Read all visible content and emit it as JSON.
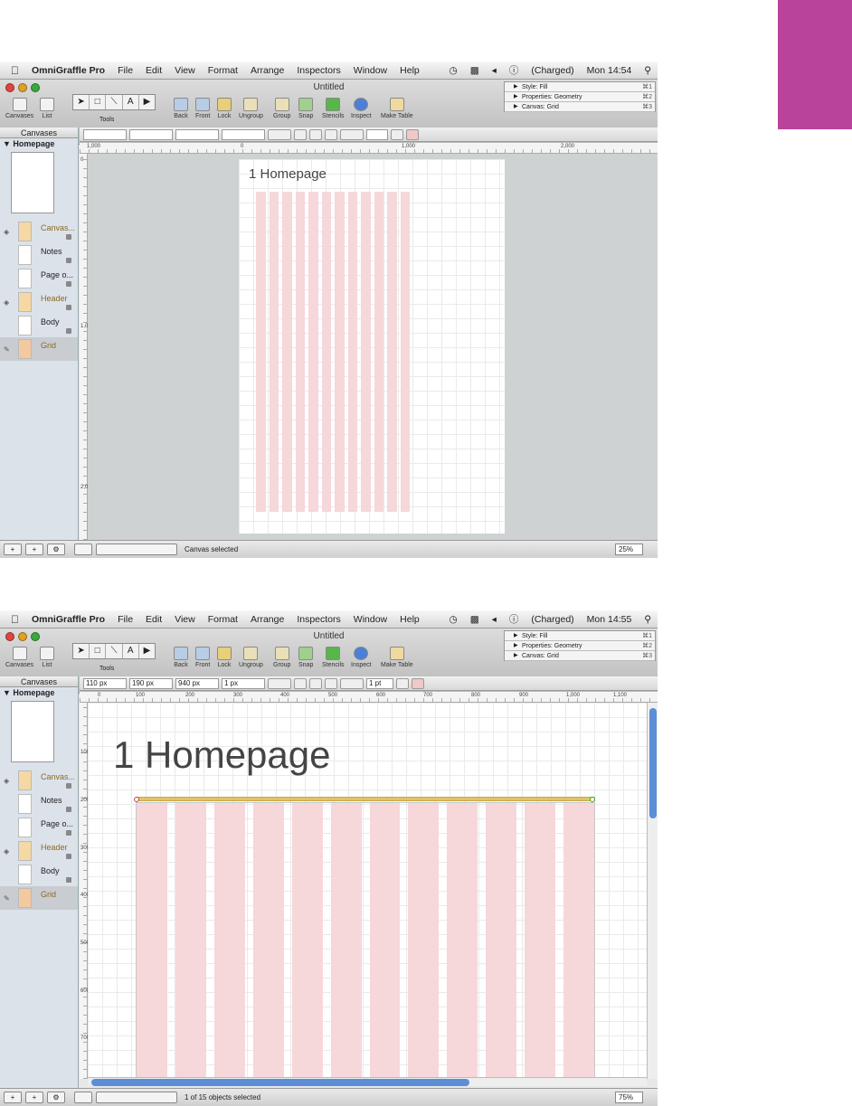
{
  "accent": "#b9439a",
  "menu": {
    "app": "OmniGraffle Pro",
    "items": [
      "File",
      "Edit",
      "View",
      "Format",
      "Arrange",
      "Inspectors",
      "Window",
      "Help"
    ],
    "battery": "(Charged)"
  },
  "s1": {
    "time": "Mon 14:54",
    "status": "Canvas selected",
    "zoom": "25%",
    "page_title": "1 Homepage"
  },
  "s2": {
    "time": "Mon 14:55",
    "status": "1 of 15 objects selected",
    "zoom": "75%",
    "page_title": "1 Homepage",
    "fields": {
      "x": "110 px",
      "y": "190 px",
      "w": "940 px",
      "h": "1 px",
      "stroke": "1 pt"
    }
  },
  "window": {
    "title": "Untitled"
  },
  "toolbar": {
    "canvases": "Canvases",
    "list": "List",
    "tools": "Tools",
    "back": "Back",
    "front": "Front",
    "lock": "Lock",
    "ungroup": "Ungroup",
    "group": "Group",
    "snap": "Snap",
    "stencils": "Stencils",
    "inspect": "Inspect",
    "make_table": "Make Table"
  },
  "inspector": [
    {
      "label": "Style: Fill",
      "key": "⌘1"
    },
    {
      "label": "Properties: Geometry",
      "key": "⌘2"
    },
    {
      "label": "Canvas: Grid",
      "key": "⌘3"
    }
  ],
  "sidebar": {
    "header": "Canvases",
    "canvas": "Homepage",
    "layers": [
      "Canvas...",
      "Notes",
      "Page o...",
      "Header",
      "Body",
      "Grid"
    ]
  },
  "ruler1": {
    "h": [
      "1,000",
      "0",
      "1,000",
      "2,000"
    ],
    "v": [
      "0",
      "1,000",
      "2,000"
    ]
  },
  "ruler2": {
    "h": [
      "0",
      "100",
      "200",
      "300",
      "400",
      "500",
      "600",
      "700",
      "800",
      "900",
      "1,000",
      "1,100"
    ],
    "v": [
      "100",
      "200",
      "300",
      "400",
      "500",
      "600",
      "700"
    ]
  }
}
